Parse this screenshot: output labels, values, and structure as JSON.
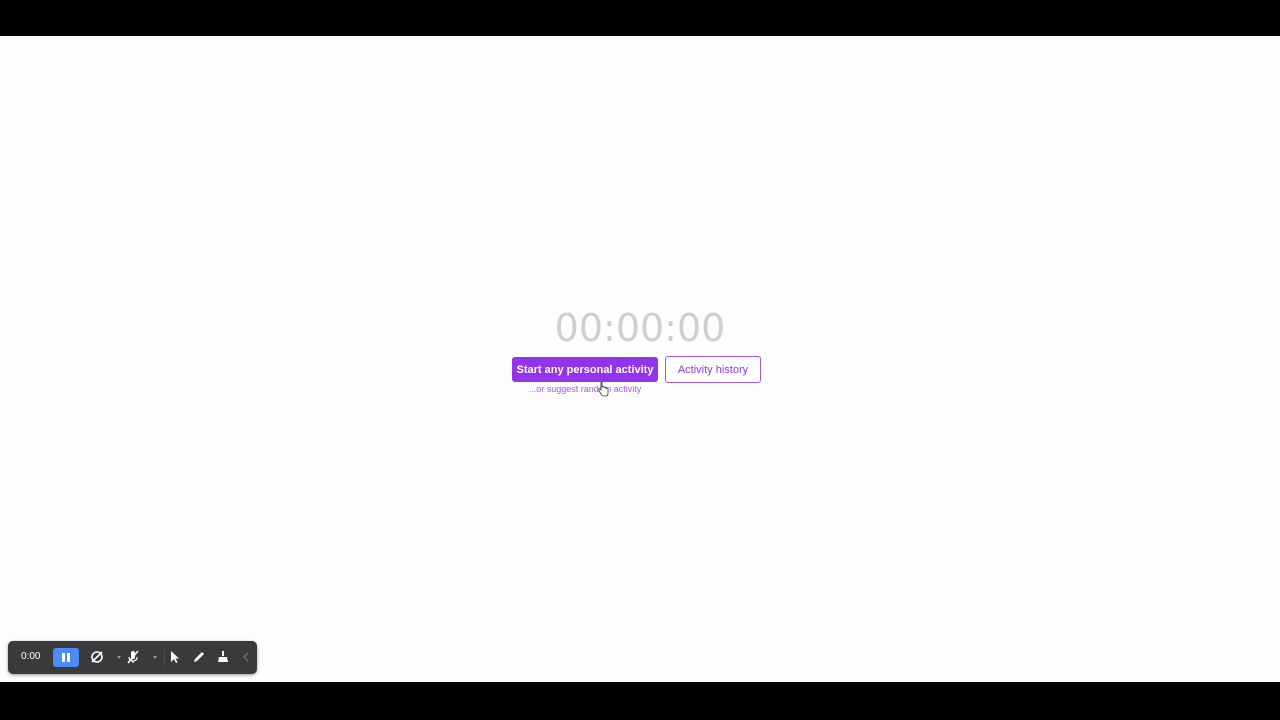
{
  "timer": {
    "display": "00:00:00"
  },
  "actions": {
    "start_label": "Start any personal activity",
    "history_label": "Activity history",
    "suggest_label": "...or suggest random activity"
  },
  "recorder_toolbar": {
    "elapsed": "0:00",
    "icons": [
      "pause-icon",
      "camera-off-icon",
      "mic-off-icon",
      "pointer-icon",
      "pen-icon",
      "eraser-icon",
      "collapse-icon"
    ]
  },
  "colors": {
    "accent": "#9333ea",
    "accent_light": "#a855f7",
    "timer_text": "#cfcfd3",
    "toolbar_bg": "#3a3a3c",
    "toolbar_active": "#4f8bf5"
  }
}
